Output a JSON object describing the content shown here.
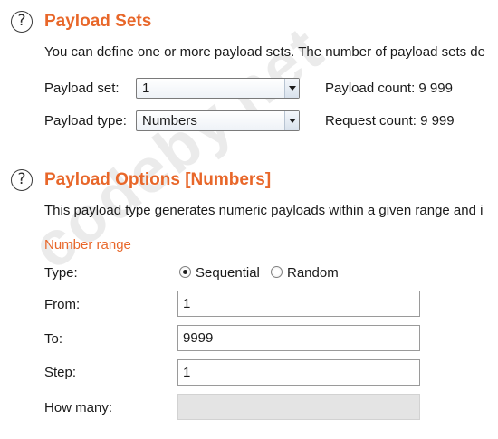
{
  "payload_sets": {
    "title": "Payload Sets",
    "description": "You can define one or more payload sets. The number of payload sets de",
    "payload_set_label": "Payload set:",
    "payload_set_value": "1",
    "payload_type_label": "Payload type:",
    "payload_type_value": "Numbers",
    "payload_count": "Payload count: 9 999",
    "request_count": "Request count: 9 999"
  },
  "payload_options": {
    "title": "Payload Options [Numbers]",
    "description": "This payload type generates numeric payloads within a given range and i",
    "number_range_heading": "Number range",
    "type_label": "Type:",
    "radio_sequential": "Sequential",
    "radio_random": "Random",
    "selected_type": "Sequential",
    "from_label": "From:",
    "from_value": "1",
    "to_label": "To:",
    "to_value": "9999",
    "step_label": "Step:",
    "step_value": "1",
    "how_many_label": "How many:",
    "how_many_value": ""
  },
  "watermark": "codeby.net",
  "icons": {
    "help": "help-icon",
    "dropdown": "chevron-down-icon"
  },
  "colors": {
    "accent": "#e8672a",
    "divider": "#cfcfcf",
    "disabled_field": "#e4e4e4"
  }
}
